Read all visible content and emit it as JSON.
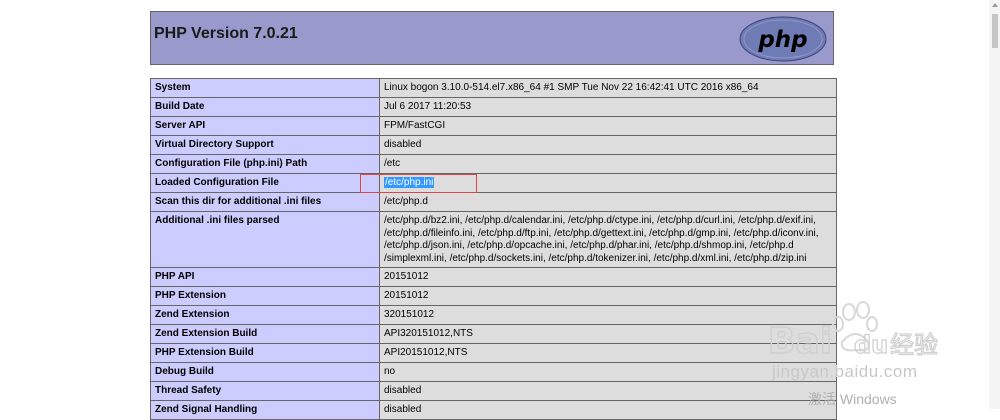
{
  "header": {
    "title": "PHP Version 7.0.21",
    "logo_text": "php"
  },
  "rows": [
    {
      "label": "System",
      "value": "Linux bogon 3.10.0-514.el7.x86_64 #1 SMP Tue Nov 22 16:42:41 UTC 2016 x86_64"
    },
    {
      "label": "Build Date",
      "value": "Jul 6 2017 11:20:53"
    },
    {
      "label": "Server API",
      "value": "FPM/FastCGI"
    },
    {
      "label": "Virtual Directory Support",
      "value": "disabled"
    },
    {
      "label": "Configuration File (php.ini) Path",
      "value": "/etc"
    },
    {
      "label": "Loaded Configuration File",
      "value": "/etc/php.ini"
    },
    {
      "label": "Scan this dir for additional .ini files",
      "value": "/etc/php.d"
    },
    {
      "label": "Additional .ini files parsed",
      "value": "/etc/php.d/bz2.ini, /etc/php.d/calendar.ini, /etc/php.d/ctype.ini, /etc/php.d/curl.ini, /etc/php.d/exif.ini, /etc/php.d/fileinfo.ini, /etc/php.d/ftp.ini, /etc/php.d/gettext.ini, /etc/php.d/gmp.ini, /etc/php.d/iconv.ini, /etc/php.d/json.ini, /etc/php.d/opcache.ini, /etc/php.d/phar.ini, /etc/php.d/shmop.ini, /etc/php.d /simplexml.ini, /etc/php.d/sockets.ini, /etc/php.d/tokenizer.ini, /etc/php.d/xml.ini, /etc/php.d/zip.ini"
    },
    {
      "label": "PHP API",
      "value": "20151012"
    },
    {
      "label": "PHP Extension",
      "value": "20151012"
    },
    {
      "label": "Zend Extension",
      "value": "320151012"
    },
    {
      "label": "Zend Extension Build",
      "value": "API320151012,NTS"
    },
    {
      "label": "PHP Extension Build",
      "value": "API20151012,NTS"
    },
    {
      "label": "Debug Build",
      "value": "no"
    },
    {
      "label": "Thread Safety",
      "value": "disabled"
    },
    {
      "label": "Zend Signal Handling",
      "value": "disabled"
    }
  ],
  "watermark": {
    "brand": "Bai du 经验",
    "url": "jingyan.baidu.com"
  },
  "os_overlay": {
    "activate_text": "激活 Windows"
  },
  "colors": {
    "header_bg": "#9999cc",
    "label_bg": "#ccccff",
    "value_bg": "#dddddd",
    "selection": "#3399ff",
    "highlight_box": "#d84848"
  }
}
